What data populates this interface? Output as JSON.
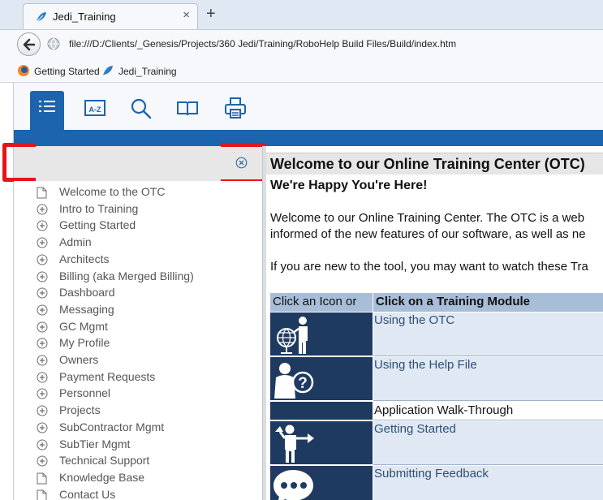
{
  "browser": {
    "tab_title": "Jedi_Training",
    "tab_close": "×",
    "new_tab": "+",
    "url": "file:///D:/Clients/_Genesis/Projects/360 Jedi/Training/RoboHelp Build Files/Build/index.htm",
    "bookmarks": [
      {
        "label": "Getting Started",
        "icon": "firefox-icon"
      },
      {
        "label": "Jedi_Training",
        "icon": "feather-icon"
      }
    ]
  },
  "toolbar": {
    "buttons": [
      {
        "name": "toc-button",
        "icon": "list-icon",
        "active": true
      },
      {
        "name": "index-button",
        "icon": "a-z-index-icon",
        "active": false
      },
      {
        "name": "search-button",
        "icon": "magnifier-icon",
        "active": false
      },
      {
        "name": "glossary-button",
        "icon": "book-icon",
        "active": false
      },
      {
        "name": "print-button",
        "icon": "printer-icon",
        "active": false
      }
    ],
    "accent_color": "#1c64ad"
  },
  "search": {
    "value": "",
    "clear_icon": "circle-x-icon"
  },
  "toc": {
    "items": [
      {
        "label": "Welcome to the OTC",
        "type": "page"
      },
      {
        "label": "Intro to Training",
        "type": "book"
      },
      {
        "label": "Getting Started",
        "type": "book"
      },
      {
        "label": "Admin",
        "type": "book"
      },
      {
        "label": "Architects",
        "type": "book"
      },
      {
        "label": "Billing (aka Merged Billing)",
        "type": "book"
      },
      {
        "label": "Dashboard",
        "type": "book"
      },
      {
        "label": "Messaging",
        "type": "book"
      },
      {
        "label": "GC Mgmt",
        "type": "book"
      },
      {
        "label": "My Profile",
        "type": "book"
      },
      {
        "label": "Owners",
        "type": "book"
      },
      {
        "label": "Payment Requests",
        "type": "book"
      },
      {
        "label": "Personnel",
        "type": "book"
      },
      {
        "label": "Projects",
        "type": "book"
      },
      {
        "label": "SubContractor Mgmt",
        "type": "book"
      },
      {
        "label": "SubTier Mgmt",
        "type": "book"
      },
      {
        "label": "Technical Support",
        "type": "book"
      },
      {
        "label": "Knowledge Base",
        "type": "page"
      },
      {
        "label": "Contact Us",
        "type": "page"
      }
    ]
  },
  "content": {
    "title": "Welcome to our Online Training Center (OTC)",
    "subtitle": "We're Happy You're Here!",
    "para1_line1": "Welcome to our Online Training Center. The OTC is a web",
    "para1_line2": "informed of the new features of our software, as well as ne",
    "para2": "If you are new to the tool, you may want to watch these Tra",
    "table": {
      "col1_header": "Click an Icon or",
      "col2_header": "Click on a Training Module",
      "rows": [
        {
          "module": "Using the OTC",
          "icon": "presenter-globe-icon"
        },
        {
          "module": "Using the Help File",
          "icon": "question-person-icon"
        },
        {
          "module": "Application Walk-Through",
          "section": true
        },
        {
          "module": "Getting Started",
          "icon": "direction-person-icon"
        },
        {
          "module": "Submitting Feedback",
          "icon": "speech-bubble-icon"
        }
      ]
    }
  }
}
